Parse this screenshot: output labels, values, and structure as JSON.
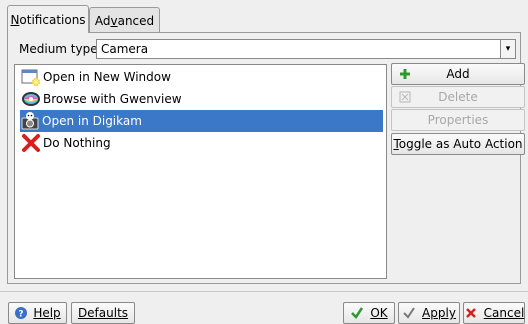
{
  "tabs": [
    {
      "label": "Notifications",
      "mnemonic": "N",
      "rest": "otifications"
    },
    {
      "label": "Advanced",
      "pre": "Ad",
      "mnemonic": "v",
      "rest": "anced"
    }
  ],
  "medium": {
    "label": "Medium types:",
    "value": "Camera"
  },
  "actions": [
    {
      "label": "Open in New Window",
      "icon": "new-window-icon"
    },
    {
      "label": "Browse with Gwenview",
      "icon": "gwenview-icon"
    },
    {
      "label": "Open in Digikam",
      "icon": "digikam-icon",
      "selected": true
    },
    {
      "label": "Do Nothing",
      "icon": "red-x-icon"
    }
  ],
  "side_buttons": {
    "add": "Add",
    "delete": "Delete",
    "properties": "Properties",
    "toggle": "Toggle as Auto Action"
  },
  "footer": {
    "help": "Help",
    "defaults": "Defaults",
    "ok": "OK",
    "apply": "Apply",
    "cancel": "Cancel"
  },
  "colors": {
    "selection": "#3b78c8",
    "ok_check": "#2e9a2e",
    "cancel_x": "#d62020",
    "help_icon": "#3a6fc8"
  }
}
